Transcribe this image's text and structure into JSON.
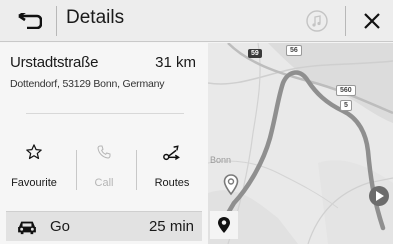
{
  "header": {
    "title": "Details"
  },
  "destination": {
    "street": "Urstadtstraße",
    "distance": "31 km",
    "address": "Dottendorf, 53129 Bonn, Germany"
  },
  "actions": [
    {
      "label": "Favourite",
      "icon": "star-outline-icon",
      "enabled": true
    },
    {
      "label": "Call",
      "icon": "phone-icon",
      "enabled": false
    },
    {
      "label": "Routes",
      "icon": "routes-icon",
      "enabled": true
    }
  ],
  "go": {
    "label": "Go",
    "time": "25 min"
  },
  "map": {
    "city_label": "Bonn",
    "road_badges": [
      "59",
      "56",
      "560",
      "5"
    ]
  },
  "colors": {
    "header_bg": "#ededed",
    "route_line": "#909090",
    "badge_dark": "#3a3a3a",
    "badge_light": "#ffffff"
  }
}
